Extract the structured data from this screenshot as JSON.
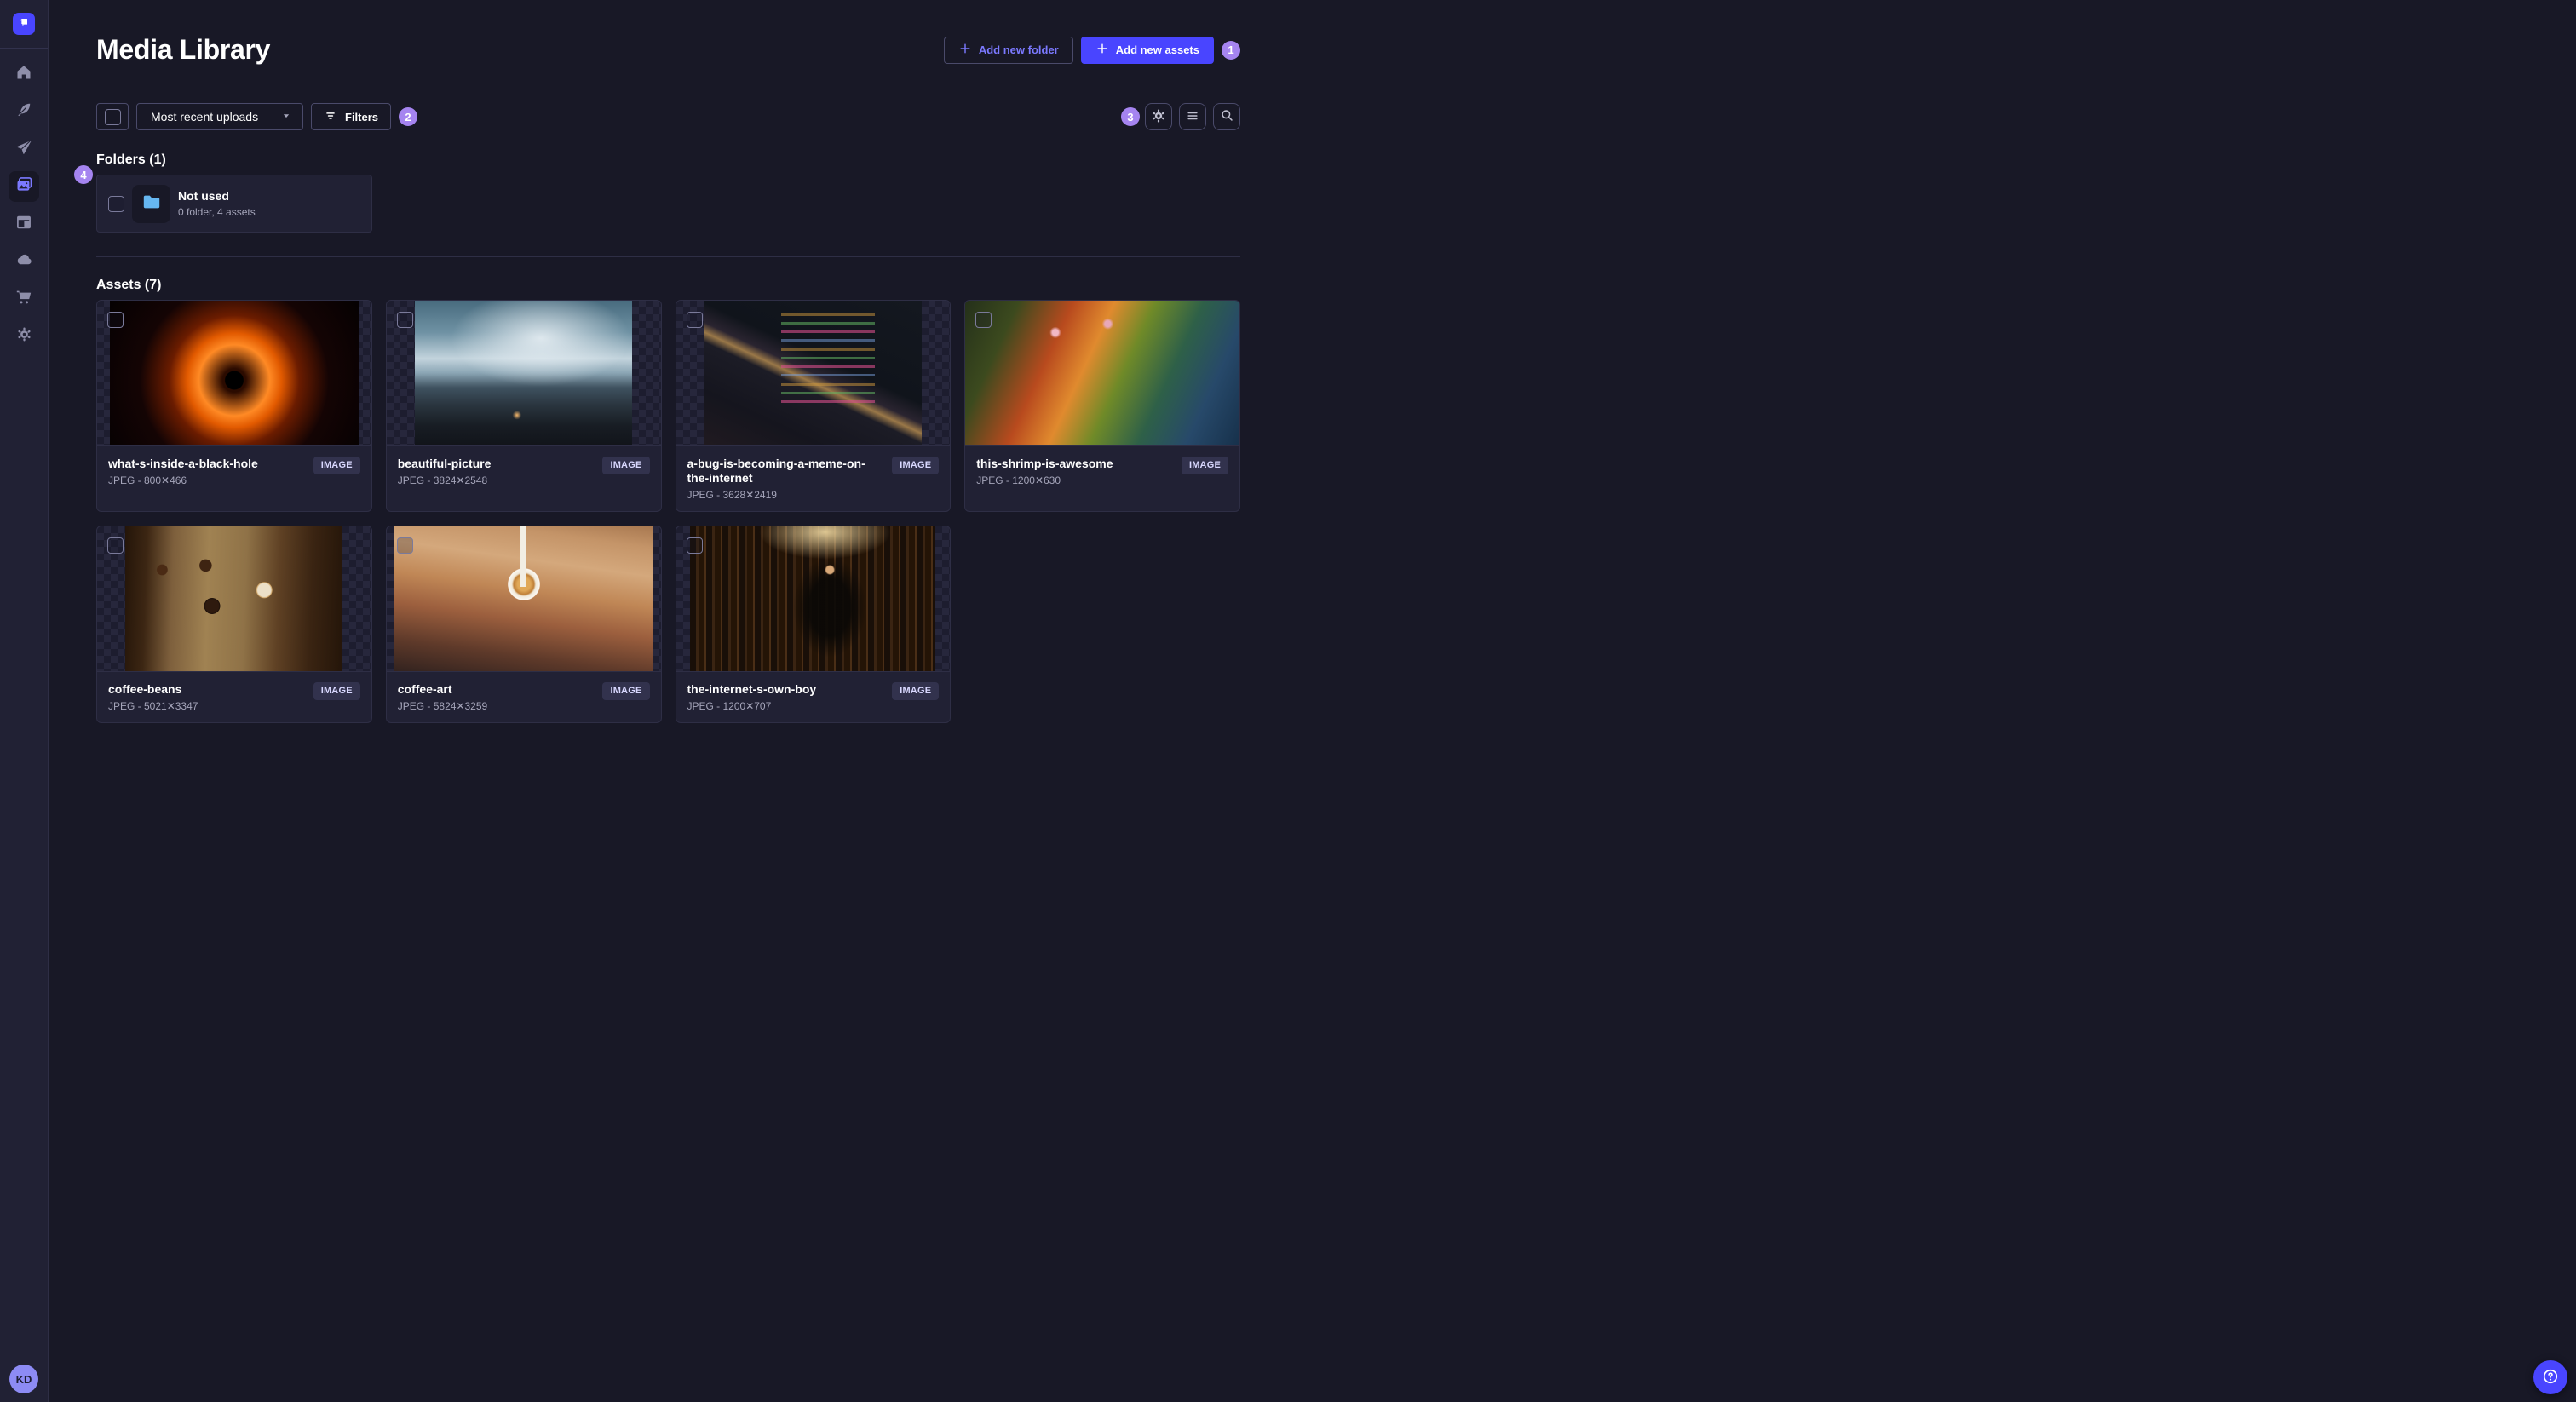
{
  "colors": {
    "primary": "#4945ff",
    "primary_light": "#7b79ff",
    "step_badge": "#a584f0",
    "folder_icon": "#66b7f1"
  },
  "sidebar": {
    "avatar_initials": "KD",
    "nav": [
      {
        "icon": "home",
        "active": false
      },
      {
        "icon": "feather",
        "active": false
      },
      {
        "icon": "send",
        "active": false
      },
      {
        "icon": "images",
        "active": true
      },
      {
        "icon": "layout",
        "active": false
      },
      {
        "icon": "cloud",
        "active": false
      },
      {
        "icon": "cart",
        "active": false
      },
      {
        "icon": "gear",
        "active": false
      }
    ]
  },
  "header": {
    "title": "Media Library",
    "add_folder_label": "Add new folder",
    "add_assets_label": "Add new assets"
  },
  "badges": {
    "assets_button": "1",
    "filters": "2",
    "view_options": "3",
    "folders_list": "4"
  },
  "toolbar": {
    "sort_value": "Most recent uploads",
    "filters_label": "Filters"
  },
  "folders": {
    "heading": "Folders (1)",
    "items": [
      {
        "name": "Not used",
        "meta": "0 folder, 4 assets"
      }
    ]
  },
  "assets": {
    "heading": "Assets (7)",
    "items": [
      {
        "title": "what-s-inside-a-black-hole",
        "meta": "JPEG - 800✕466",
        "type": "IMAGE",
        "thumb": "black-hole"
      },
      {
        "title": "beautiful-picture",
        "meta": "JPEG - 3824✕2548",
        "type": "IMAGE",
        "thumb": "mountains"
      },
      {
        "title": "a-bug-is-becoming-a-meme-on-the-internet",
        "meta": "JPEG - 3628✕2419",
        "type": "IMAGE",
        "thumb": "code"
      },
      {
        "title": "this-shrimp-is-awesome",
        "meta": "JPEG - 1200✕630",
        "type": "IMAGE",
        "thumb": "shrimp"
      },
      {
        "title": "coffee-beans",
        "meta": "JPEG - 5021✕3347",
        "type": "IMAGE",
        "thumb": "coffee-beans"
      },
      {
        "title": "coffee-art",
        "meta": "JPEG - 5824✕3259",
        "type": "IMAGE",
        "thumb": "coffee-art"
      },
      {
        "title": "the-internet-s-own-boy",
        "meta": "JPEG - 1200✕707",
        "type": "IMAGE",
        "thumb": "library"
      }
    ]
  }
}
